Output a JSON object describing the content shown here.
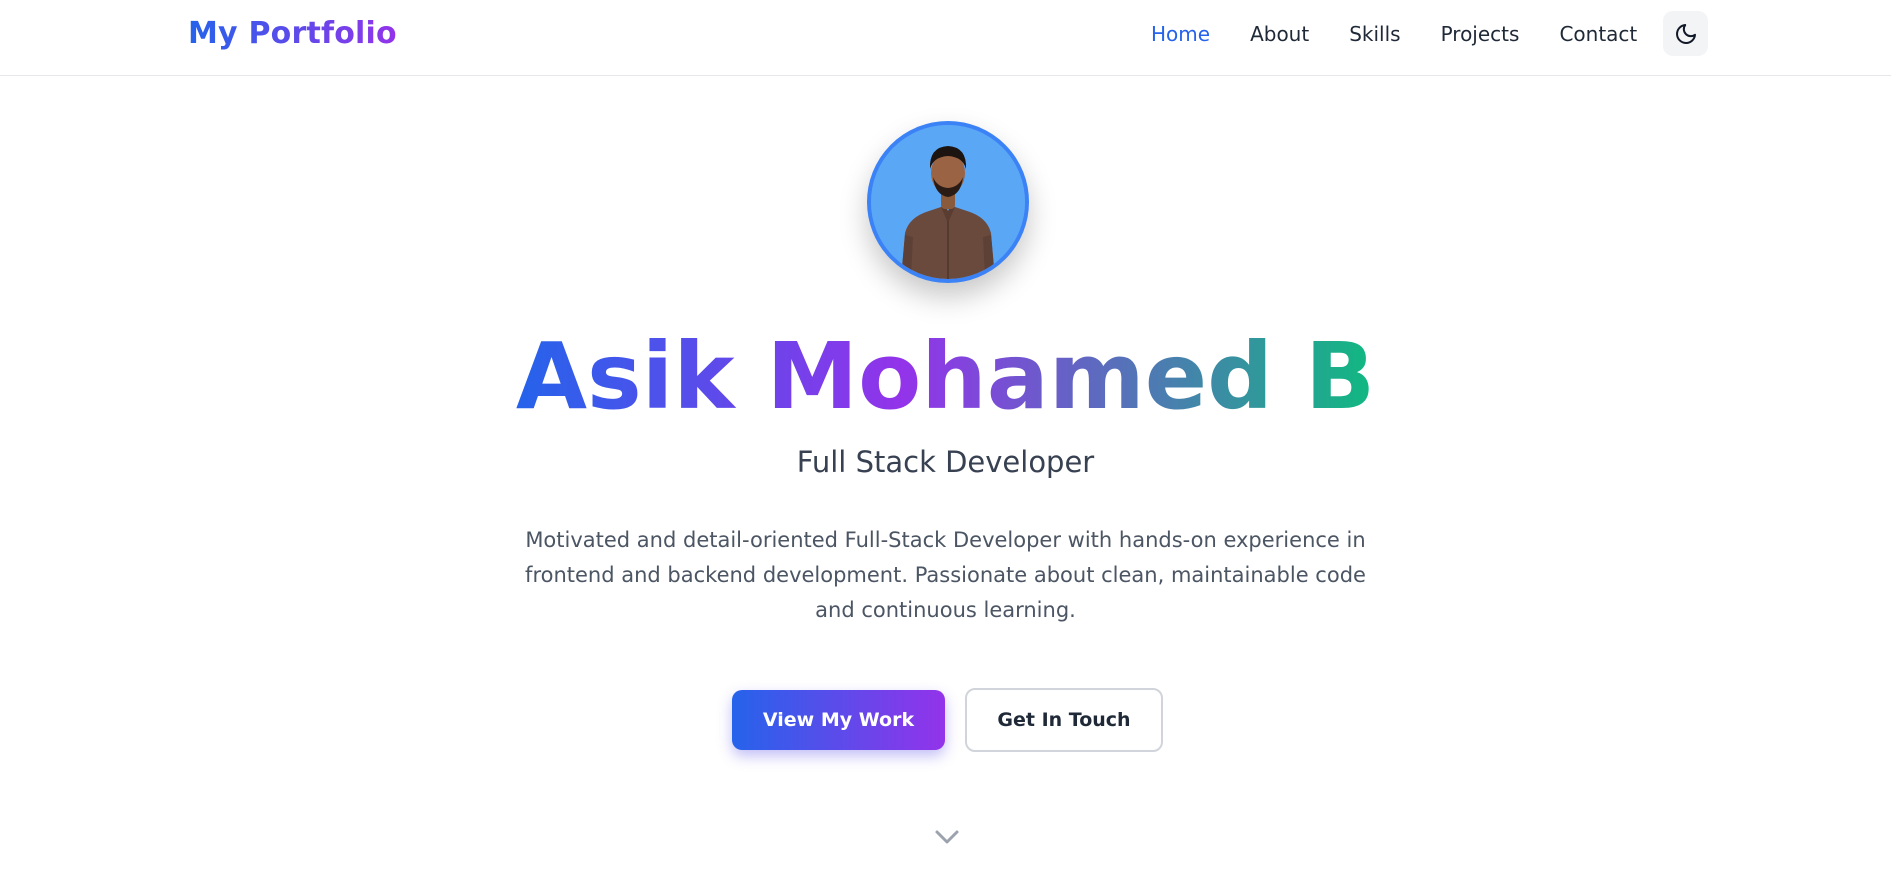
{
  "header": {
    "logo": "My Portfolio",
    "nav": [
      {
        "label": "Home",
        "active": true
      },
      {
        "label": "About",
        "active": false
      },
      {
        "label": "Skills",
        "active": false
      },
      {
        "label": "Projects",
        "active": false
      },
      {
        "label": "Contact",
        "active": false
      }
    ],
    "theme_toggle_icon": "moon-icon"
  },
  "hero": {
    "avatar_icon": "profile-photo",
    "name": "Asik Mohamed B",
    "role": "Full Stack Developer",
    "bio": "Motivated and detail-oriented Full-Stack Developer with hands-on experience in frontend and backend development. Passionate about clean, maintainable code and continuous learning.",
    "primary_button": "View My Work",
    "secondary_button": "Get In Touch",
    "scroll_icon": "chevron-down-icon"
  },
  "colors": {
    "accent_blue": "#2563eb",
    "accent_purple": "#9333ea",
    "accent_green": "#10b981",
    "avatar_bg": "#5aa7f6"
  }
}
